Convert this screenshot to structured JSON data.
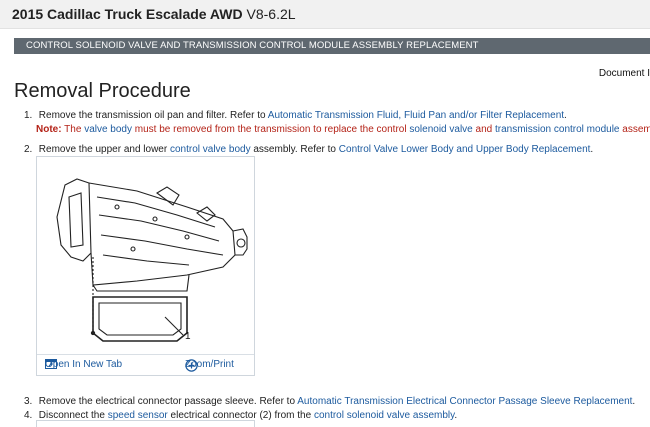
{
  "header": {
    "vehicle": "2015 Cadillac Truck Escalade AWD",
    "engine": "V8-6.2L"
  },
  "banner": "CONTROL SOLENOID VALVE AND TRANSMISSION CONTROL MODULE ASSEMBLY REPLACEMENT",
  "doc_id_label": "Document I",
  "heading": "Removal Procedure",
  "steps": [
    {
      "num": "1.",
      "text": "Remove the transmission oil pan and filter. Refer to",
      "link": "Automatic Transmission Fluid, Fluid Pan and/or Filter Replacement",
      "end": "."
    },
    {
      "num": "2.",
      "pre": "Remove the upper and lower",
      "link1": "control valve body",
      "mid": "assembly. Refer to",
      "link2": "Control Valve Lower Body and Upper Body Replacement",
      "end": "."
    },
    {
      "num": "3.",
      "text": "Remove the electrical connector passage sleeve. Refer to",
      "link": "Automatic Transmission Electrical Connector Passage Sleeve Replacement",
      "end": "."
    },
    {
      "num": "4.",
      "pre": "Disconnect the",
      "link1": "speed sensor",
      "mid": "electrical connector (2) from the",
      "link2": "control solenoid valve assembly",
      "end": "."
    }
  ],
  "note": {
    "label": "Note:",
    "t1": "The",
    "l1": "valve body",
    "t2": "must be removed from the transmission to replace the control",
    "l2": "solenoid valve",
    "t3": "and",
    "l3": "transmission control module",
    "t4": "assembly."
  },
  "figure": {
    "callout": "1",
    "open_tab_label": "Open In New Tab",
    "zoom_label": "Zoom/Print"
  },
  "colors": {
    "link": "#1c5a9e",
    "note": "#b42318",
    "banner": "#5f6870"
  }
}
